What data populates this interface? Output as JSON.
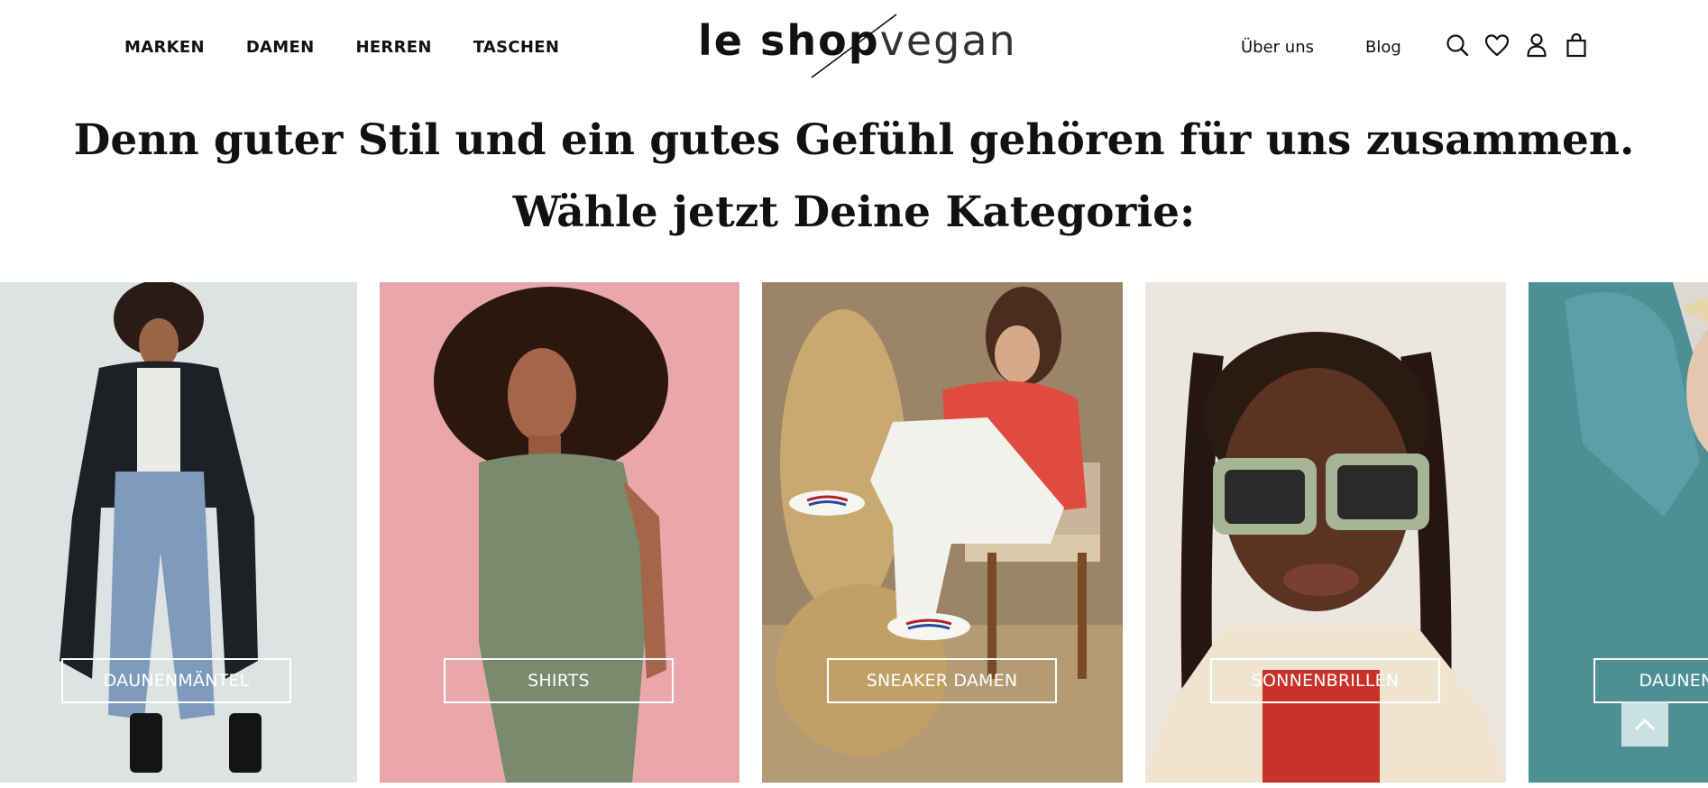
{
  "header": {
    "nav_left": [
      "MARKEN",
      "DAMEN",
      "HERREN",
      "TASCHEN"
    ],
    "logo": {
      "part1": "le shop",
      "part2": "vegan"
    },
    "nav_right": [
      "Über uns",
      "Blog"
    ],
    "icons": [
      "search-icon",
      "heart-icon",
      "user-icon",
      "bag-icon"
    ]
  },
  "headline": {
    "line1": "Denn guter Stil und ein gutes Gefühl gehören für uns zusammen.",
    "line2": "Wähle jetzt Deine Kategorie:"
  },
  "categories": [
    {
      "label": "DAUNENMÄNTEL",
      "bg": "#dfe2e3"
    },
    {
      "label": "SHIRTS",
      "bg": "#e9a7a9"
    },
    {
      "label": "SNEAKER DAMEN",
      "bg": "#a58a6c"
    },
    {
      "label": "SONNENBRILLEN",
      "bg": "#e8e3dd"
    },
    {
      "label": "DAUNENJACKEN",
      "bg": "#4e8f96"
    }
  ],
  "scroll_top_icon": "chevron-up-icon"
}
